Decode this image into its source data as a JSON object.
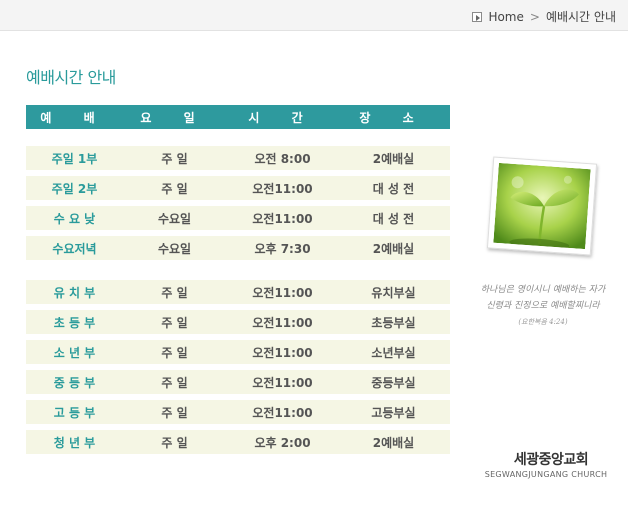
{
  "breadcrumb": {
    "home": "Home",
    "separator": ">",
    "current": "예배시간 안내"
  },
  "page_title": "예배시간 안내",
  "table": {
    "headers": [
      "예 배",
      "요 일",
      "시 간",
      "장 소"
    ],
    "group1": [
      {
        "name": "주일 1부",
        "day": "주 일",
        "time": "오전 8:00",
        "place": "2예배실"
      },
      {
        "name": "주일 2부",
        "day": "주 일",
        "time": "오전11:00",
        "place": "대 성 전"
      },
      {
        "name": "수 요 낮",
        "day": "수요일",
        "time": "오전11:00",
        "place": "대 성 전"
      },
      {
        "name": "수요저녁",
        "day": "수요일",
        "time": "오후 7:30",
        "place": "2예배실"
      }
    ],
    "group2": [
      {
        "name": "유 치 부",
        "day": "주 일",
        "time": "오전11:00",
        "place": "유치부실"
      },
      {
        "name": "초 등 부",
        "day": "주 일",
        "time": "오전11:00",
        "place": "초등부실"
      },
      {
        "name": "소 년 부",
        "day": "주 일",
        "time": "오전11:00",
        "place": "소년부실"
      },
      {
        "name": "중 등 부",
        "day": "주 일",
        "time": "오전11:00",
        "place": "중등부실"
      },
      {
        "name": "고 등 부",
        "day": "주 일",
        "time": "오전11:00",
        "place": "고등부실"
      },
      {
        "name": "청 년 부",
        "day": "주 일",
        "time": "오후 2:00",
        "place": "2예배실"
      }
    ]
  },
  "verse": {
    "line1": "하나님은 영이시니 예배하는 자가",
    "line2": "신령과 진정으로 예배할찌니라",
    "reference": "(요한복음 4:24)"
  },
  "church": {
    "name": "세광중앙교회",
    "english": "SEGWANGJUNGANG CHURCH"
  },
  "colors": {
    "accent": "#2e9a9e",
    "row_bg": "#f5f6e4",
    "title": "#2a9b9b"
  },
  "icons": {
    "breadcrumb_home": "arrow-right-box-icon"
  }
}
